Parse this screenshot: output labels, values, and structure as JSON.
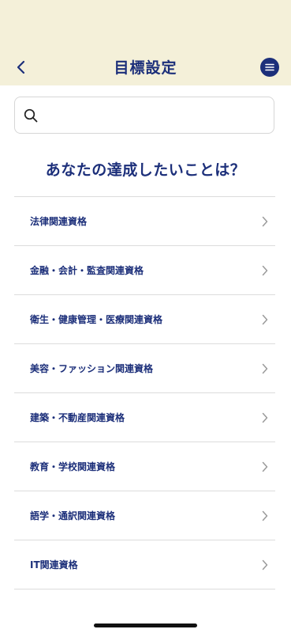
{
  "header": {
    "title": "目標設定",
    "accent_color": "#1c2f7a",
    "background_color": "#f4f0d9",
    "back_icon": "chevron-left-icon",
    "menu_icon": "hamburger-menu-icon"
  },
  "search": {
    "placeholder": "",
    "value": "",
    "icon": "search-icon"
  },
  "main": {
    "question": "あなたの達成したいことは？",
    "categories": [
      {
        "label": "法律関連資格"
      },
      {
        "label": "金融・会計・監査関連資格"
      },
      {
        "label": "衛生・健康管理・医療関連資格"
      },
      {
        "label": "美容・ファッション関連資格"
      },
      {
        "label": "建築・不動産関連資格"
      },
      {
        "label": "教育・学校関連資格"
      },
      {
        "label": "語学・通訳関連資格"
      },
      {
        "label": "IT関連資格"
      }
    ]
  }
}
